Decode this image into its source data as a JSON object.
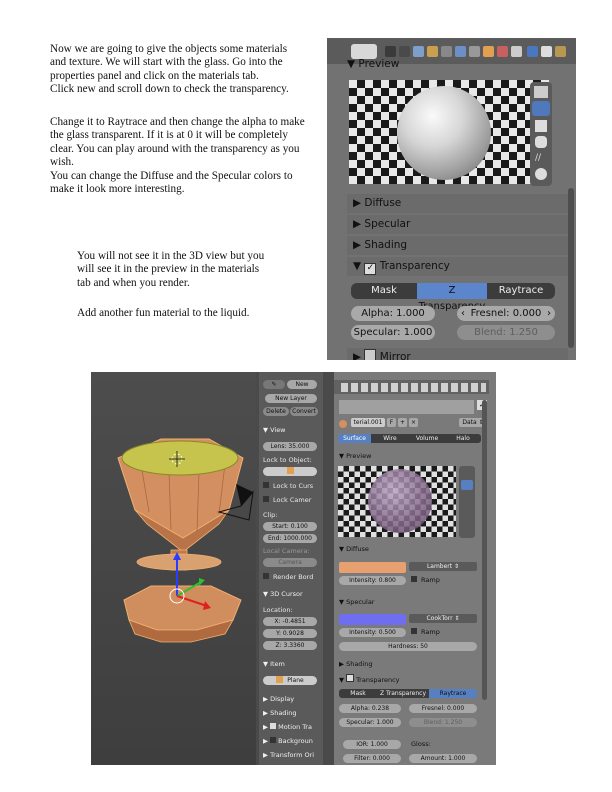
{
  "paragraphs": {
    "p1": "Now we are going to give the objects some materials\nand texture. We will start with the glass. Go into the\nproperties panel and click on the materials tab.\nClick new and scroll down to check the transparency.",
    "p2": "Change it to Raytrace and then change the alpha to make\nthe glass transparent. If it is at 0 it will be completely\nclear. You can play around with the transparency as you\nwish.\nYou can change the Diffuse and the Specular colors to\nmake it look more interesting.",
    "p3": "You will not see it in the 3D view but you\nwill see it in the preview in the materials\ntab and when you render.",
    "p4": "Add another fun material to the liquid."
  },
  "top_panel": {
    "preview_label": "Preview",
    "sections": [
      "Diffuse",
      "Specular",
      "Shading"
    ],
    "transparency_label": "Transparency",
    "modes": [
      "Mask",
      "Z Transparency",
      "Raytrace"
    ],
    "active_mode": "Z Transparency",
    "alpha": "Alpha: 1.000",
    "fresnel": "Fresnel: 0.000",
    "specular": "Specular: 1.000",
    "blend": "Blend: 1.250",
    "mirror_label": "Mirror"
  },
  "toolshelf": {
    "new_btn": "New",
    "new_layer": "New Layer",
    "delete": "Delete",
    "convert": "Convert",
    "view": "View",
    "lens": "Lens: 35.000",
    "lock_to_object": "Lock to Object:",
    "lock_to_cursor": "Lock to Curs",
    "lock_camera": "Lock Camer",
    "clip": "Clip:",
    "clip_start": "Start: 0.100",
    "clip_end": "End: 1000.000",
    "local_camera": "Local Camera:",
    "camera": "Camera",
    "render_border": "Render Bord",
    "cursor_3d": "3D Cursor",
    "location": "Location:",
    "x": "X: -0.4851",
    "y": "Y: 0.9028",
    "z": "Z: 3.3360",
    "item": "Item",
    "item_name": "Plane",
    "display": "Display",
    "shading": "Shading",
    "motion": "Motion Tra",
    "background": "Backgroun",
    "transform": "Transform Ori"
  },
  "bottom_panel": {
    "material_name": "terial.001",
    "f_label": "F",
    "data_label": "Data",
    "tabs": [
      "Surface",
      "Wire",
      "Volume",
      "Halo"
    ],
    "active_tab": "Surface",
    "preview_label": "Preview",
    "diffuse_label": "Diffuse",
    "diffuse_color": "#e8a070",
    "diffuse_shader": "Lambert",
    "diffuse_intensity": "Intensity: 0.800",
    "ramp": "Ramp",
    "specular_label": "Specular",
    "specular_color": "#6f6ef0",
    "specular_shader": "CookTorr",
    "specular_intensity": "Intensity: 0.500",
    "hardness": "Hardness: 50",
    "shading_label": "Shading",
    "transparency_label": "Transparency",
    "modes": [
      "Mask",
      "Z Transparency",
      "Raytrace"
    ],
    "active_mode": "Raytrace",
    "alpha": "Alpha: 0.238",
    "fresnel": "Fresnel: 0.000",
    "specular": "Specular: 1.000",
    "blend": "Blend: 1.250",
    "ior": "IOR: 1.000",
    "gloss": "Gloss:",
    "filter": "Filter: 0.000",
    "amount": "Amount: 1.000"
  },
  "colors": {
    "panel_bg": "#727272",
    "dark_bg": "#4a4a4a",
    "active_blue": "#5680c2",
    "glass_orange": "#d08d5e",
    "liquid_yellow": "#c4c24a"
  }
}
